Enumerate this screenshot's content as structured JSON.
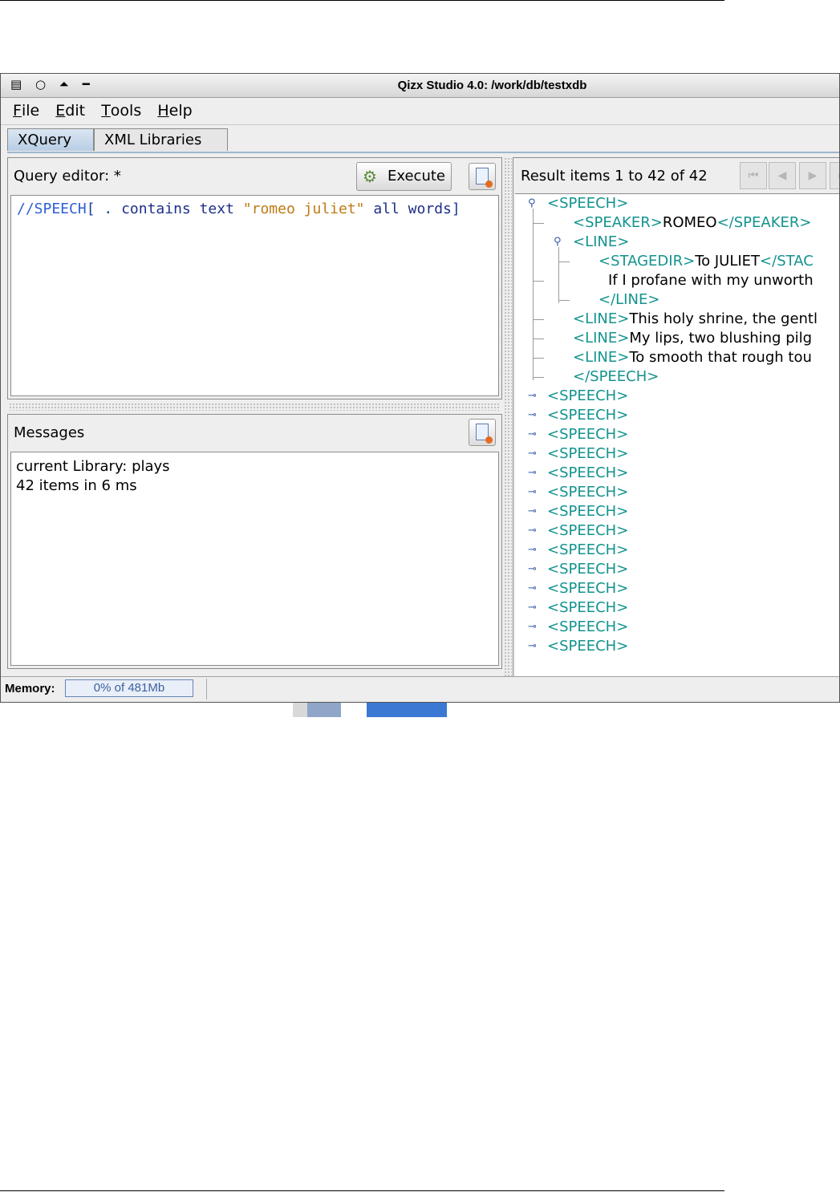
{
  "window": {
    "title": "Qizx Studio 4.0: /work/db/testxdb",
    "controls": "▤ ○ ⏶ ━"
  },
  "menu": [
    {
      "label": "File",
      "mnemonic": "F",
      "rest": "ile"
    },
    {
      "label": "Edit",
      "mnemonic": "E",
      "rest": "dit"
    },
    {
      "label": "Tools",
      "mnemonic": "T",
      "rest": "ools"
    },
    {
      "label": "Help",
      "mnemonic": "H",
      "rest": "elp"
    }
  ],
  "tabs": [
    {
      "label": "XQuery",
      "active": true
    },
    {
      "label": "XML Libraries",
      "active": false
    }
  ],
  "query_editor": {
    "title": "Query editor:  *",
    "execute_label": "Execute",
    "code": {
      "path": "//SPEECH",
      "part1": "[ . ",
      "kw1": "contains text ",
      "str": "\"romeo juliet\"",
      "kw2": " all words",
      "end": "]"
    }
  },
  "messages": {
    "title": "Messages",
    "lines": [
      "current Library: plays",
      "42 items in 6 ms"
    ]
  },
  "results": {
    "title": "Result items 1 to 42 of 42",
    "tree": {
      "n0": "<SPEECH>",
      "n1_open": "<SPEAKER>",
      "n1_text": "ROMEO",
      "n1_close": "</SPEAKER>",
      "n2": "<LINE>",
      "n3_open": "<STAGEDIR>",
      "n3_text": "To JULIET",
      "n3_close": "</STAC",
      "n4_text": "If I profane with my unworth",
      "n5": "</LINE>",
      "n6_open": "<LINE>",
      "n6_text": "This holy shrine, the gentl",
      "n7_open": "<LINE>",
      "n7_text": "My lips, two blushing pilg",
      "n8_open": "<LINE>",
      "n8_text": "To smooth that rough tou",
      "n9": "</SPEECH>",
      "collapsed_label": "<SPEECH>"
    },
    "nav": [
      "first",
      "prev",
      "next",
      "last"
    ]
  },
  "status": {
    "memory_label": "Memory:",
    "memory_value": "0% of 481Mb"
  },
  "colors": {
    "tag": "#13938e",
    "code_keyword": "#1c2e8a",
    "code_string": "#c07a14",
    "tab_active": "#b8cde4"
  }
}
